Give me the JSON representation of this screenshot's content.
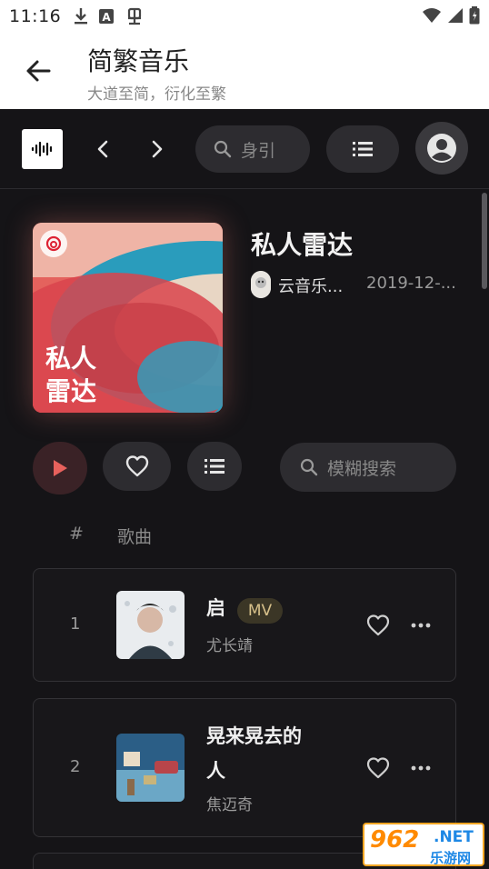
{
  "status_bar": {
    "time": "11:16",
    "icons_left": [
      "download-icon",
      "a-box-icon",
      "bug-icon"
    ],
    "icons_right": [
      "wifi-icon",
      "signal-icon",
      "battery-icon"
    ]
  },
  "app_bar": {
    "title": "简繁音乐",
    "subtitle": "大道至简，衍化至繁"
  },
  "top_bar": {
    "search_text": "身引"
  },
  "playlist": {
    "title": "私人雷达",
    "cover_text_line1": "私人",
    "cover_text_line2": "雷达",
    "author": "云音乐...",
    "date": "2019-12-..."
  },
  "actions": {
    "filter_placeholder": "模糊搜索"
  },
  "columns": {
    "index": "#",
    "song": "歌曲"
  },
  "songs": [
    {
      "index": "1",
      "title": "启",
      "mv": "MV",
      "artist": "尤长靖"
    },
    {
      "index": "2",
      "title_line1": "晃来晃去的",
      "title_line2": "人",
      "artist": "焦迈奇"
    }
  ],
  "watermark": {
    "number": "962",
    "net": ".NET",
    "cn": "乐游网"
  },
  "colors": {
    "background_dark": "#151417",
    "play_accent": "#e8615c",
    "mv_badge_text": "#d7c08a"
  }
}
